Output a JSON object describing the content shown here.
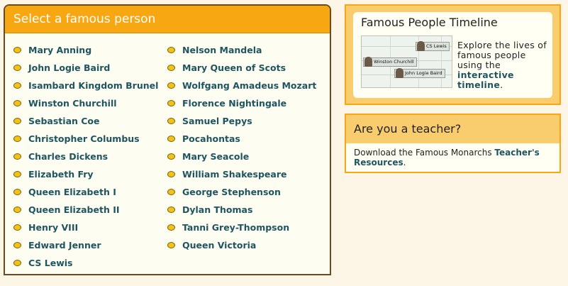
{
  "people_panel": {
    "title": "Select a famous person",
    "left_column": [
      "Mary Anning",
      "John Logie Baird",
      "Isambard Kingdom Brunel",
      "Winston Churchill",
      "Sebastian Coe",
      "Christopher Columbus",
      "Charles Dickens",
      "Elizabeth Fry",
      "Queen Elizabeth I",
      "Queen Elizabeth II",
      "Henry VIII",
      "Edward Jenner",
      "CS Lewis"
    ],
    "right_column": [
      "Nelson Mandela",
      "Mary Queen of Scots",
      "Wolfgang Amadeus Mozart",
      "Florence Nightingale",
      "Samuel Pepys",
      "Pocahontas",
      "Mary Seacole",
      "William Shakespeare",
      "George Stephenson",
      "Dylan Thomas",
      "Tanni Grey-Thompson",
      "Queen Victoria"
    ]
  },
  "timeline": {
    "title": "Famous People Timeline",
    "text_before": "Explore the lives of famous people using the ",
    "link": "interactive timeline",
    "text_after": ".",
    "image_labels": {
      "card1": "CS Lewis",
      "card2": "Winston Churchill",
      "card3": "John Logie Baird"
    }
  },
  "teacher": {
    "title": "Are you a teacher?",
    "text_before": "Download the Famous Monarchs ",
    "link": "Teacher's Resources",
    "text_after": "."
  },
  "colors": {
    "header_orange": "#f7a711",
    "light_orange": "#f9cc6d",
    "link_teal": "#1f5560",
    "border_brown": "#6b4a1f"
  }
}
